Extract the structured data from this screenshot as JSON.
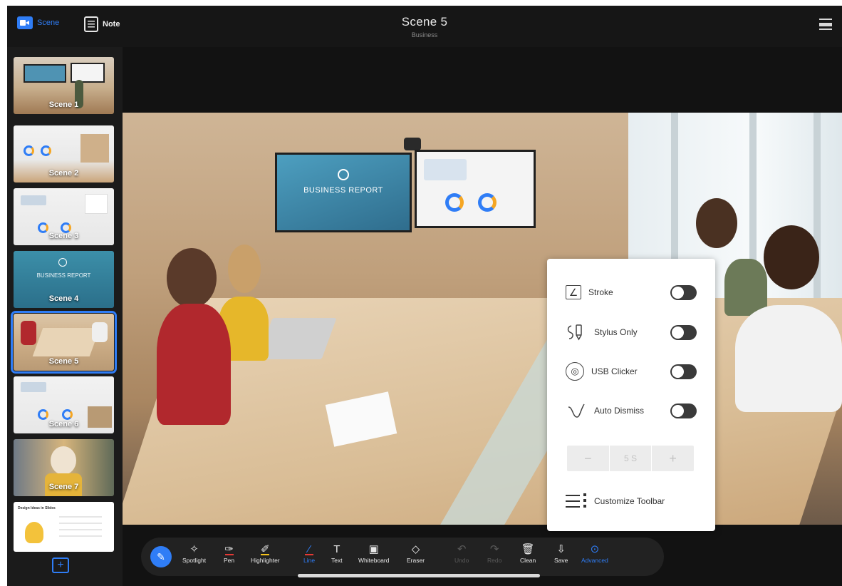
{
  "topbar": {
    "scene_label": "Scene",
    "note_label": "Note",
    "title": "Scene 5",
    "subtitle": "Business"
  },
  "sidebar": {
    "scenes": [
      {
        "label": "Scene 1"
      },
      {
        "label": "Scene 2"
      },
      {
        "label": "Scene 3"
      },
      {
        "label": "Scene 4",
        "slide_title": "BUSINESS REPORT"
      },
      {
        "label": "Scene 5"
      },
      {
        "label": "Scene 6"
      },
      {
        "label": "Scene 7"
      },
      {
        "label": "",
        "slide_title": "Design Ideas in Slides"
      }
    ],
    "active_index": 4,
    "add_label": "+"
  },
  "stage": {
    "tv_title": "BUSINESS REPORT"
  },
  "panel": {
    "stroke_label": "Stroke",
    "stylus_label": "Stylus Only",
    "usb_label": "USB Clicker",
    "auto_dismiss_label": "Auto Dismiss",
    "stepper_minus": "−",
    "stepper_value": "5 S",
    "stepper_plus": "+",
    "customize_label": "Customize Toolbar",
    "toggles": {
      "stroke": false,
      "stylus_only": false,
      "usb_clicker": false,
      "auto_dismiss": false
    }
  },
  "toolbar": {
    "spotlight": "Spotlight",
    "pen": "Pen",
    "highlighter": "Highlighter",
    "line": "Line",
    "text": "Text",
    "whiteboard": "Whiteboard",
    "eraser": "Eraser",
    "undo": "Undo",
    "redo": "Redo",
    "clean": "Clean",
    "save": "Save",
    "advanced": "Advanced"
  },
  "colors": {
    "accent": "#2f7df6",
    "pen_underline": "#e53935",
    "highlighter_underline": "#f5c21b",
    "line_underline": "#e53935"
  }
}
